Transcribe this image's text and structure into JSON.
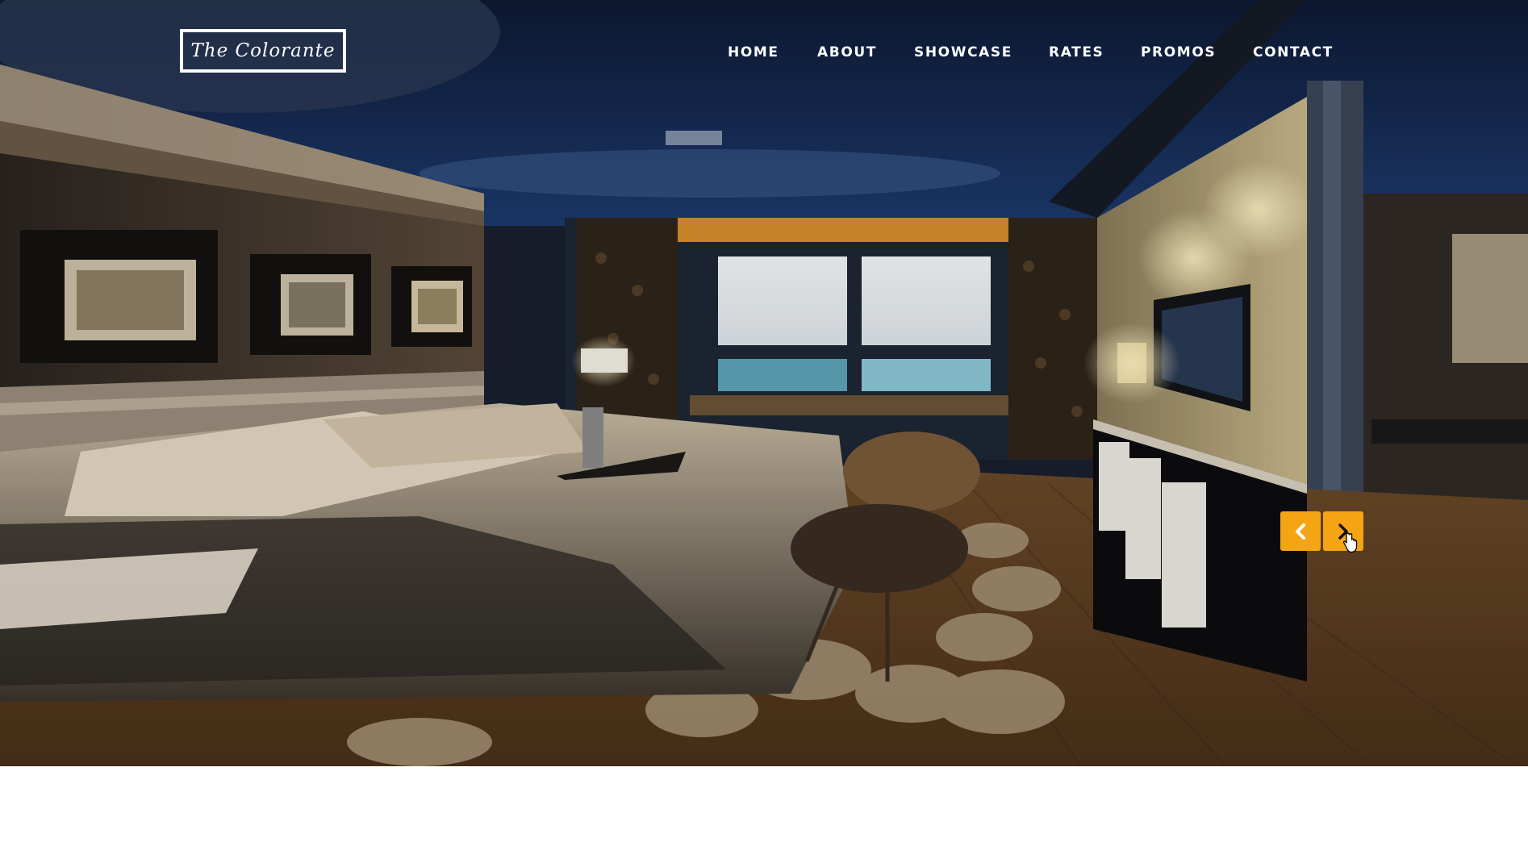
{
  "brand": {
    "logo_text": "The Colorante"
  },
  "nav": {
    "items": [
      {
        "label": "HOME"
      },
      {
        "label": "ABOUT"
      },
      {
        "label": "SHOWCASE"
      },
      {
        "label": "RATES"
      },
      {
        "label": "PROMOS"
      },
      {
        "label": "CONTACT"
      }
    ]
  },
  "carousel": {
    "prev_icon": "chevron-left-icon",
    "next_icon": "chevron-right-icon",
    "hero_image": "hotel-bedroom-photo"
  },
  "colors": {
    "accent": "#f5a413",
    "nav_text": "#ffffff",
    "page_background": "#ffffff"
  }
}
